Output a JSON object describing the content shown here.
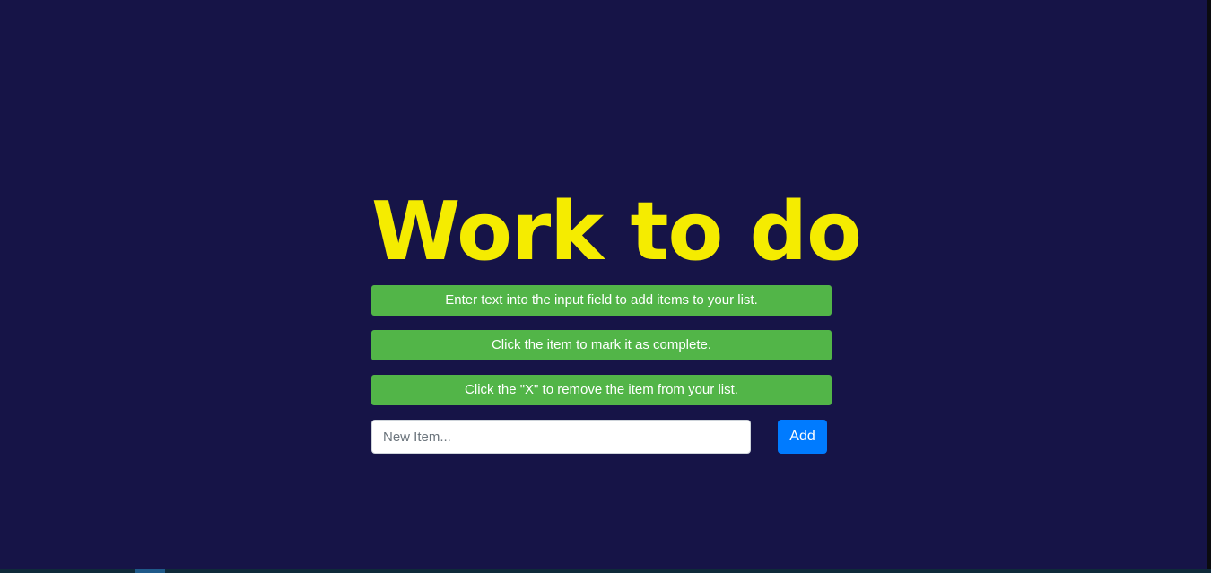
{
  "app": {
    "title": "Work to do"
  },
  "instructions": [
    {
      "text": "Enter text into the input field to add items to your list."
    },
    {
      "text": "Click the item to mark it as complete."
    },
    {
      "text": "Click the \"X\" to remove the item from your list."
    }
  ],
  "form": {
    "input_value": "",
    "input_placeholder": "New Item...",
    "add_label": "Add"
  },
  "colors": {
    "background": "#161447",
    "title": "#f5ec00",
    "instruction_bg": "#52b548",
    "add_button": "#007bff"
  }
}
